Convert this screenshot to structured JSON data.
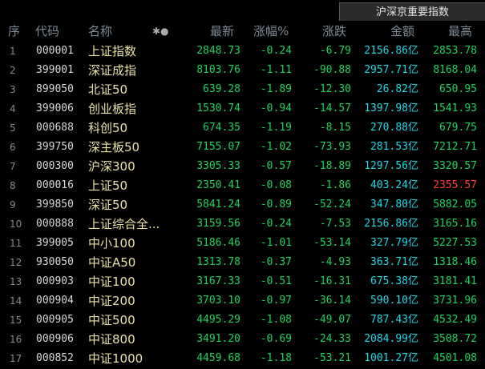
{
  "tab": {
    "label": "沪深京重要指数"
  },
  "columns": {
    "index": "序",
    "code": "代码",
    "name": "名称",
    "star": "✱●",
    "last": "最新",
    "change_pct": "涨幅%",
    "change": "涨跌",
    "amount": "金额",
    "high": "最高"
  },
  "colors": {
    "up": "#ff3b3b",
    "down": "#1fd35a",
    "amount": "#20d6e6",
    "name": "#e9e0a6"
  },
  "rows": [
    {
      "i": "1",
      "code": "000001",
      "name": "上证指数",
      "last": "2848.73",
      "pct": "-0.24",
      "chg": "-6.79",
      "amt": "2156.86亿",
      "high": "2853.78",
      "high_up": false
    },
    {
      "i": "2",
      "code": "399001",
      "name": "深证成指",
      "last": "8103.76",
      "pct": "-1.11",
      "chg": "-90.88",
      "amt": "2957.71亿",
      "high": "8168.04",
      "high_up": false
    },
    {
      "i": "3",
      "code": "899050",
      "name": "北证50",
      "last": "639.28",
      "pct": "-1.89",
      "chg": "-12.30",
      "amt": "26.82亿",
      "high": "650.95",
      "high_up": false
    },
    {
      "i": "4",
      "code": "399006",
      "name": "创业板指",
      "last": "1530.74",
      "pct": "-0.94",
      "chg": "-14.57",
      "amt": "1397.98亿",
      "high": "1541.93",
      "high_up": false
    },
    {
      "i": "5",
      "code": "000688",
      "name": "科创50",
      "last": "674.35",
      "pct": "-1.19",
      "chg": "-8.15",
      "amt": "270.88亿",
      "high": "679.75",
      "high_up": false
    },
    {
      "i": "6",
      "code": "399750",
      "name": "深主板50",
      "last": "7155.07",
      "pct": "-1.02",
      "chg": "-73.93",
      "amt": "281.53亿",
      "high": "7212.71",
      "high_up": false
    },
    {
      "i": "7",
      "code": "000300",
      "name": "沪深300",
      "last": "3305.33",
      "pct": "-0.57",
      "chg": "-18.89",
      "amt": "1297.56亿",
      "high": "3320.57",
      "high_up": false
    },
    {
      "i": "8",
      "code": "000016",
      "name": "上证50",
      "last": "2350.41",
      "pct": "-0.08",
      "chg": "-1.86",
      "amt": "403.24亿",
      "high": "2355.57",
      "high_up": true
    },
    {
      "i": "9",
      "code": "399850",
      "name": "深证50",
      "last": "5841.24",
      "pct": "-0.89",
      "chg": "-52.24",
      "amt": "347.80亿",
      "high": "5882.05",
      "high_up": false
    },
    {
      "i": "10",
      "code": "000888",
      "name": "上证综合全...",
      "last": "3159.56",
      "pct": "-0.24",
      "chg": "-7.53",
      "amt": "2156.86亿",
      "high": "3165.16",
      "high_up": false
    },
    {
      "i": "11",
      "code": "399005",
      "name": "中小100",
      "last": "5186.46",
      "pct": "-1.01",
      "chg": "-53.14",
      "amt": "327.79亿",
      "high": "5227.53",
      "high_up": false
    },
    {
      "i": "12",
      "code": "930050",
      "name": "中证A50",
      "last": "1313.78",
      "pct": "-0.37",
      "chg": "-4.93",
      "amt": "363.71亿",
      "high": "1318.46",
      "high_up": false
    },
    {
      "i": "13",
      "code": "000903",
      "name": "中证100",
      "last": "3167.33",
      "pct": "-0.51",
      "chg": "-16.31",
      "amt": "675.38亿",
      "high": "3181.41",
      "high_up": false
    },
    {
      "i": "14",
      "code": "000904",
      "name": "中证200",
      "last": "3703.10",
      "pct": "-0.97",
      "chg": "-36.14",
      "amt": "590.10亿",
      "high": "3731.96",
      "high_up": false
    },
    {
      "i": "15",
      "code": "000905",
      "name": "中证500",
      "last": "4495.29",
      "pct": "-1.08",
      "chg": "-49.07",
      "amt": "787.43亿",
      "high": "4532.49",
      "high_up": false
    },
    {
      "i": "16",
      "code": "000906",
      "name": "中证800",
      "last": "3491.20",
      "pct": "-0.69",
      "chg": "-24.33",
      "amt": "2084.99亿",
      "high": "3508.72",
      "high_up": false
    },
    {
      "i": "17",
      "code": "000852",
      "name": "中证1000",
      "last": "4459.68",
      "pct": "-1.18",
      "chg": "-53.21",
      "amt": "1001.27亿",
      "high": "4501.08",
      "high_up": false
    }
  ]
}
